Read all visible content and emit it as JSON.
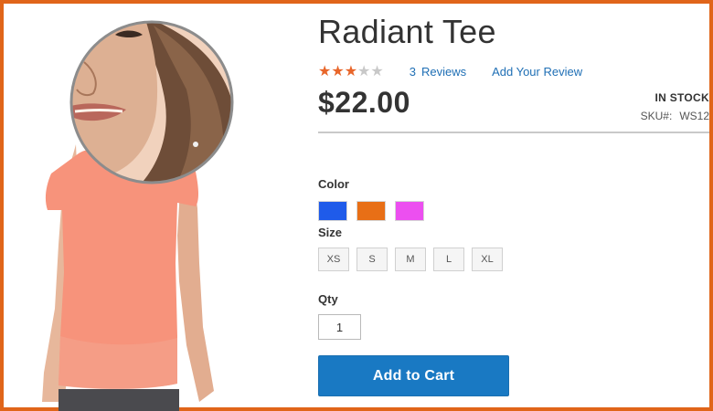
{
  "product": {
    "title": "Radiant Tee",
    "rating_stars": 3,
    "rating_max": 5,
    "review_count": "3",
    "review_label": "Reviews",
    "add_review_label": "Add Your Review",
    "price": "$22.00",
    "stock_status": "IN STOCK",
    "sku_label": "SKU#:",
    "sku_value": "WS12"
  },
  "options": {
    "color_label": "Color",
    "colors": [
      {
        "name": "blue-swatch",
        "hex": "#1f5bea"
      },
      {
        "name": "orange-swatch",
        "hex": "#e86f16"
      },
      {
        "name": "purple-swatch",
        "hex": "#ec4ff0"
      }
    ],
    "size_label": "Size",
    "sizes": [
      "XS",
      "S",
      "M",
      "L",
      "XL"
    ],
    "qty_label": "Qty",
    "qty_value": "1"
  },
  "actions": {
    "add_to_cart_label": "Add to Cart"
  },
  "colors": {
    "frame": "#e0651a",
    "link": "#1f6fb5",
    "star_on": "#e8662a",
    "button": "#1979c3"
  }
}
